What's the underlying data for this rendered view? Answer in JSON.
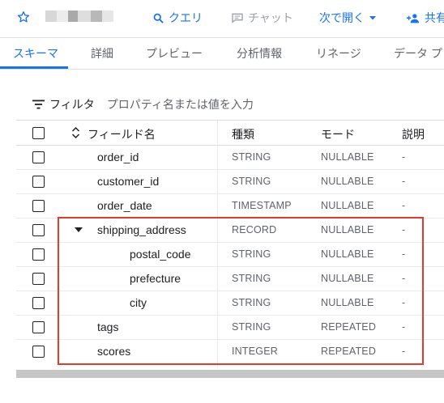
{
  "toolbar": {
    "query_label": "クエリ",
    "chat_label": "チャット",
    "open_label": "次で開く",
    "share_label": "共有",
    "icons": [
      "star-icon",
      "search-icon",
      "chat-icon",
      "chevron-down-icon",
      "add-person-icon"
    ]
  },
  "tabs": [
    {
      "label": "スキーマ",
      "active": true
    },
    {
      "label": "詳細"
    },
    {
      "label": "プレビュー"
    },
    {
      "label": "分析情報"
    },
    {
      "label": "リネージ"
    },
    {
      "label": "データ プ"
    }
  ],
  "filter": {
    "label": "フィルタ",
    "placeholder": "プロパティ名または値を入力"
  },
  "table": {
    "headers": {
      "name": "フィールド名",
      "type": "種類",
      "mode": "モード",
      "description": "説明"
    },
    "rows": [
      {
        "name": "order_id",
        "type": "STRING",
        "mode": "NULLABLE",
        "description": "-"
      },
      {
        "name": "customer_id",
        "type": "STRING",
        "mode": "NULLABLE",
        "description": "-"
      },
      {
        "name": "order_date",
        "type": "TIMESTAMP",
        "mode": "NULLABLE",
        "description": "-"
      },
      {
        "name": "shipping_address",
        "type": "RECORD",
        "mode": "NULLABLE",
        "description": "-"
      },
      {
        "name": "postal_code",
        "type": "STRING",
        "mode": "NULLABLE",
        "description": "-"
      },
      {
        "name": "prefecture",
        "type": "STRING",
        "mode": "NULLABLE",
        "description": "-"
      },
      {
        "name": "city",
        "type": "STRING",
        "mode": "NULLABLE",
        "description": "-"
      },
      {
        "name": "tags",
        "type": "STRING",
        "mode": "REPEATED",
        "description": "-"
      },
      {
        "name": "scores",
        "type": "INTEGER",
        "mode": "REPEATED",
        "description": "-"
      }
    ]
  },
  "colors": {
    "accent": "#1a73e8",
    "highlight": "#e53b2c"
  }
}
